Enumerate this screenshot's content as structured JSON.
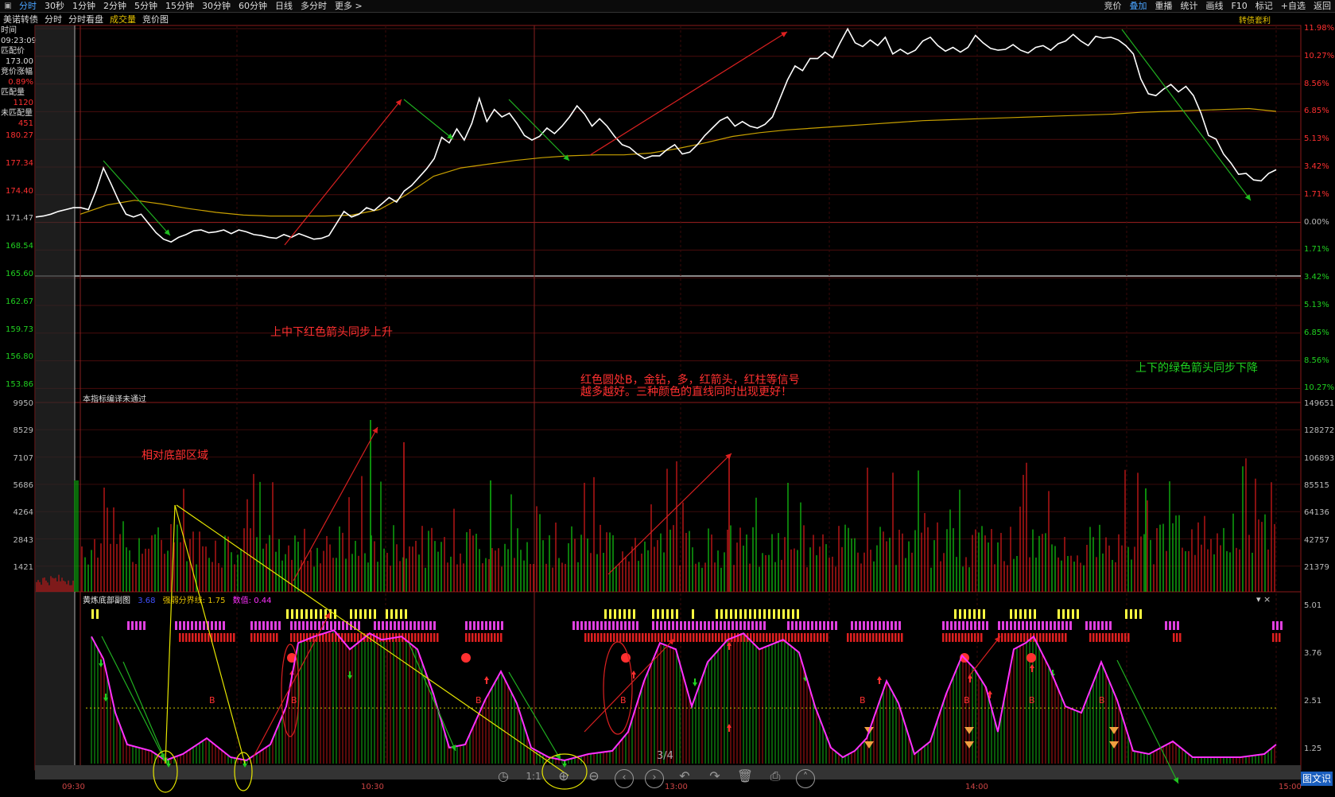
{
  "top_tabs": [
    "分时",
    "30秒",
    "1分钟",
    "2分钟",
    "5分钟",
    "15分钟",
    "30分钟",
    "60分钟",
    "日线",
    "多分时",
    "更多 >"
  ],
  "active_tab": "分时",
  "right_tabs": [
    "竞价",
    "叠加",
    "重播",
    "统计",
    "画线",
    "F10",
    "标记",
    "+自选",
    "返回"
  ],
  "sub_bar": {
    "name": "美诺转债",
    "items": [
      "分时",
      "分时看盘"
    ],
    "volume": "成交量",
    "auction": "竞价图",
    "right_label": "转债套利"
  },
  "left_info": [
    {
      "label": "时间",
      "value": "09:23:09"
    },
    {
      "label": "匹配价",
      "value": "173.00"
    },
    {
      "label": "竞价涨幅",
      "value": "0.89%"
    },
    {
      "label": "匹配量",
      "value": "1120"
    },
    {
      "label": "未匹配量",
      "value": "451"
    }
  ],
  "price_left": [
    "180.27",
    "177.34",
    "174.40",
    "171.47",
    "168.54",
    "165.60",
    "162.67",
    "159.73",
    "156.80",
    "153.86"
  ],
  "pct_right": [
    "11.98%",
    "10.27%",
    "8.56%",
    "6.85%",
    "5.13%",
    "3.42%",
    "1.71%",
    "0.00%",
    "1.71%",
    "3.42%",
    "5.13%",
    "6.85%",
    "8.56%",
    "10.27%"
  ],
  "vol_left": [
    "9950",
    "8529",
    "7107",
    "5686",
    "4264",
    "2843",
    "1421"
  ],
  "vol_right": [
    "149651",
    "128272",
    "106893",
    "85515",
    "64136",
    "42757",
    "21379"
  ],
  "indicator": {
    "name": "黄炼底部副图",
    "v1": "3.68",
    "line_label": "强弱分界线: 1.75",
    "value_label": "数值: 0.44",
    "ticks": [
      "5.01",
      "3.76",
      "2.51",
      "1.25"
    ]
  },
  "vol_note": "本指标编译未通过",
  "annotations": {
    "a1": "上中下红色箭头同步上升",
    "a2": "红色圆处B，金钻，多，红箭头，红柱等信号越多越好。三种颜色的直线同时出现更好！",
    "a3": "上下的绿色箭头同步下降",
    "a4": "相对底部区域"
  },
  "x_labels": [
    "09:30",
    "10:30",
    "13:00",
    "14:00",
    "15:00"
  ],
  "pager": "3/4",
  "badge": "图文识",
  "chart_data": {
    "type": "line",
    "price": {
      "ylim": [
        165.6,
        191.53
      ],
      "base": 171.47,
      "series": [
        {
          "name": "price",
          "values": [
            171.2,
            171.3,
            171.5,
            171.8,
            172.0,
            172.2,
            172.2,
            172.0,
            174.0,
            176.5,
            174.8,
            173.0,
            171.5,
            171.2,
            171.5,
            170.5,
            169.5,
            168.8,
            168.5,
            169.0,
            169.3,
            169.7,
            169.8,
            169.5,
            169.6,
            169.8,
            169.4,
            169.8,
            169.6,
            169.3,
            169.2,
            169.0,
            168.9,
            169.3,
            169.0,
            169.4,
            169.1,
            168.8,
            168.9,
            169.2,
            170.5,
            171.8,
            171.2,
            171.5,
            172.2,
            171.9,
            172.6,
            173.3,
            172.8,
            174.0,
            174.6,
            175.5,
            176.4,
            177.5,
            179.8,
            179.2,
            180.7,
            179.5,
            181.3,
            184.0,
            181.5,
            182.8,
            182.0,
            182.4,
            181.3,
            180.0,
            179.5,
            179.9,
            180.8,
            180.2,
            181.0,
            182.0,
            183.2,
            182.3,
            181.0,
            181.8,
            181.0,
            179.9,
            179.0,
            178.7,
            178.0,
            177.5,
            177.8,
            177.8,
            178.5,
            179.0,
            178.0,
            178.2,
            179.0,
            180.0,
            180.8,
            181.6,
            182.0,
            181.0,
            181.5,
            181.0,
            180.8,
            181.2,
            182.0,
            184.0,
            186.0,
            187.5,
            187.0,
            188.3,
            188.3,
            189.0,
            188.4,
            190.0,
            191.5,
            190.0,
            189.6,
            190.3,
            189.7,
            190.6,
            188.8,
            189.3,
            188.8,
            189.2,
            190.2,
            190.6,
            189.7,
            189.1,
            189.5,
            189.0,
            189.5,
            190.8,
            190.0,
            189.4,
            189.2,
            189.3,
            189.8,
            189.2,
            188.9,
            189.5,
            189.7,
            189.2,
            189.9,
            190.2,
            190.9,
            190.2,
            189.7,
            190.7,
            190.5,
            190.6,
            190.3,
            189.7,
            188.8,
            186.1,
            184.5,
            184.3,
            185.0,
            185.5,
            184.7,
            185.3,
            184.3,
            182.4,
            180.0,
            179.6,
            178.0,
            177.0,
            175.8,
            175.9,
            175.2,
            175.1,
            175.9,
            176.3
          ]
        },
        {
          "name": "avg",
          "values": [
            171.5,
            172.5,
            173.0,
            172.6,
            172.1,
            171.7,
            171.4,
            171.3,
            171.3,
            171.3,
            171.4,
            172.0,
            173.6,
            175.6,
            176.5,
            176.9,
            177.3,
            177.6,
            177.8,
            177.9,
            177.9,
            178.1,
            178.6,
            179.2,
            179.9,
            180.3,
            180.6,
            180.8,
            181.0,
            181.2,
            181.4,
            181.6,
            181.7,
            181.8,
            181.9,
            182.0,
            182.1,
            182.2,
            182.3,
            182.5,
            182.6,
            182.7,
            182.8,
            182.9,
            182.6
          ]
        }
      ]
    },
    "volume": {
      "ylim": [
        0,
        10000
      ]
    },
    "indicator": {
      "ylim": [
        0,
        5.01
      ],
      "threshold": 1.75
    }
  }
}
